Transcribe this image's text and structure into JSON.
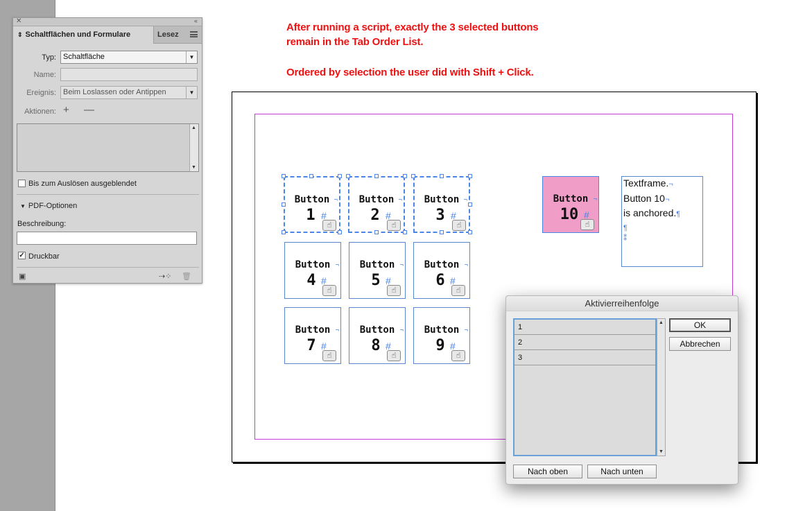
{
  "panel": {
    "active_tab": "Schaltflächen und Formulare",
    "inactive_tab": "Lesez",
    "type_label": "Typ:",
    "type_value": "Schaltfläche",
    "name_label": "Name:",
    "name_value": "",
    "event_label": "Ereignis:",
    "event_value": "Beim Loslassen oder Antippen",
    "actions_label": "Aktionen:",
    "add_symbol": "+",
    "remove_symbol": "—",
    "hidden_until_triggered_label": "Bis zum Auslösen ausgeblendet",
    "hidden_until_triggered_checked": false,
    "pdf_options_label": "PDF-Optionen",
    "description_label": "Beschreibung:",
    "description_value": "",
    "printable_label": "Druckbar",
    "printable_checked": true
  },
  "notes": {
    "line1": "After running a script, exactly the 3 selected buttons",
    "line2": "remain in the Tab Order List.",
    "line3": "Ordered by selection the user did with Shift + Click."
  },
  "document": {
    "buttons": [
      {
        "label": "Button",
        "number": "1",
        "selected": true
      },
      {
        "label": "Button",
        "number": "2",
        "selected": true
      },
      {
        "label": "Button",
        "number": "3",
        "selected": true
      },
      {
        "label": "Button",
        "number": "4",
        "selected": false
      },
      {
        "label": "Button",
        "number": "5",
        "selected": false
      },
      {
        "label": "Button",
        "number": "6",
        "selected": false
      },
      {
        "label": "Button",
        "number": "7",
        "selected": false
      },
      {
        "label": "Button",
        "number": "8",
        "selected": false
      },
      {
        "label": "Button",
        "number": "9",
        "selected": false
      }
    ],
    "anchored_button": {
      "label": "Button",
      "number": "10",
      "color": "#f09ec8"
    },
    "hash": "#",
    "textframe_lines": [
      "Textframe.",
      "Button 10",
      "is anchored."
    ]
  },
  "dialog": {
    "title": "Aktivierreihenfolge",
    "items": [
      "1",
      "2",
      "3"
    ],
    "ok_label": "OK",
    "cancel_label": "Abbrechen",
    "up_label": "Nach oben",
    "down_label": "Nach unten"
  },
  "colors": {
    "note_red": "#ee1111",
    "frame_blue": "#4a86e8",
    "margin_magenta": "#c23bd4"
  }
}
